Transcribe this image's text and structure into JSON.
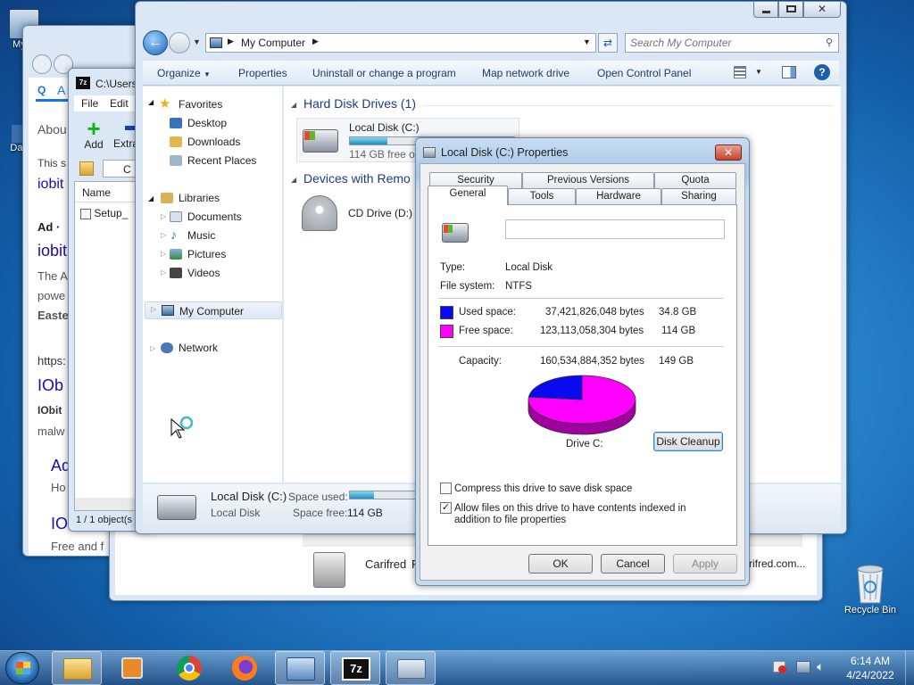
{
  "desktop": {
    "icons": [
      {
        "label": "My C"
      },
      {
        "label": "Data"
      },
      {
        "label": "Recycle Bin"
      }
    ]
  },
  "browser": {
    "tab_letter": "A",
    "lines": [
      "Abou",
      "This s",
      "iobit",
      "Ad ·",
      "iobit",
      "The A",
      "powe",
      "Easte",
      "https:",
      "IOb",
      "IObit",
      "malw",
      "Ad",
      "Ho",
      "IO",
      "Free and f"
    ]
  },
  "sevenzip": {
    "path": "C:\\Users",
    "menu": [
      "File",
      "Edit"
    ],
    "add_label": "Add",
    "extract_label": "Extra",
    "path_short": "C",
    "column_name": "Name",
    "file": "Setup_",
    "status": "1 / 1 object(s"
  },
  "carifred": {
    "name": "Carifred",
    "letter": "F",
    "url": "rifred.com..."
  },
  "explorer": {
    "address": "My Computer",
    "search_placeholder": "Search My Computer",
    "toolbar": [
      "Organize",
      "Properties",
      "Uninstall or change a program",
      "Map network drive",
      "Open Control Panel"
    ],
    "nav": {
      "favorites": "Favorites",
      "fav_items": [
        "Desktop",
        "Downloads",
        "Recent Places"
      ],
      "libraries": "Libraries",
      "lib_items": [
        "Documents",
        "Music",
        "Pictures",
        "Videos"
      ],
      "computer": "My Computer",
      "network": "Network"
    },
    "groups": {
      "hdd": "Hard Disk Drives (1)",
      "devices": "Devices with Remo"
    },
    "local_disk": {
      "name": "Local Disk (C:)",
      "free": "114 GB free of",
      "used_fraction": 0.23
    },
    "cd_drive": "CD Drive (D:)",
    "details": {
      "name": "Local Disk (C:)",
      "type": "Local Disk",
      "space_used_label": "Space used:",
      "space_free_label": "Space free:",
      "space_free_value": "114 GB"
    }
  },
  "dialog": {
    "title": "Local Disk (C:) Properties",
    "tabs_back": [
      "Security",
      "Previous Versions",
      "Quota"
    ],
    "tabs_front": [
      "General",
      "Tools",
      "Hardware",
      "Sharing"
    ],
    "name_value": "",
    "type_label": "Type:",
    "type_value": "Local Disk",
    "fs_label": "File system:",
    "fs_value": "NTFS",
    "used_label": "Used space:",
    "used_bytes": "37,421,826,048 bytes",
    "used_gb": "34.8 GB",
    "free_label": "Free space:",
    "free_bytes": "123,113,058,304 bytes",
    "free_gb": "114 GB",
    "capacity_label": "Capacity:",
    "capacity_bytes": "160,534,884,352 bytes",
    "capacity_gb": "149 GB",
    "drive_label": "Drive C:",
    "used_fraction": 0.233,
    "used_color": "#0a0af0",
    "free_color": "#ff00ff",
    "cleanup_button": "Disk Cleanup",
    "compress_label": "Compress this drive to save disk space",
    "compress_checked": false,
    "index_label": "Allow files on this drive to have contents indexed in addition to file properties",
    "index_checked": true,
    "ok": "OK",
    "cancel": "Cancel",
    "apply": "Apply"
  },
  "taskbar": {
    "time": "6:14 AM",
    "date": "4/24/2022"
  }
}
